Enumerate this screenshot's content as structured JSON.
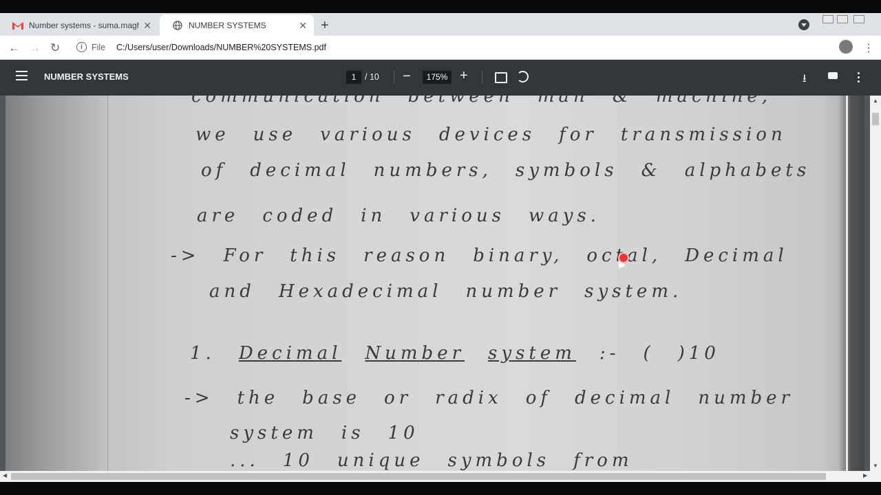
{
  "tabs": [
    {
      "title": "Number systems - suma.maghan",
      "favicon": "gmail-icon"
    },
    {
      "title": "NUMBER SYSTEMS",
      "favicon": "globe-icon"
    }
  ],
  "address": {
    "scheme_label": "File",
    "url": "C:/Users/user/Downloads/NUMBER%20SYSTEMS.pdf"
  },
  "pdf_viewer": {
    "title": "NUMBER SYSTEMS",
    "current_page": "1",
    "total_pages": "/ 10",
    "zoom": "175%"
  },
  "document_text": [
    [
      "communication",
      "between",
      "man",
      "&",
      "machine,"
    ],
    [
      "we",
      "use",
      "various",
      "devices",
      "for",
      "transmission"
    ],
    [
      "of",
      "decimal",
      "numbers,",
      "symbols",
      "&",
      "alphabets"
    ],
    [
      "are",
      "coded",
      "in",
      "various",
      "ways."
    ],
    [
      "->",
      "For",
      "this",
      "reason",
      "binary,",
      "octal,",
      "Decimal"
    ],
    [
      "and",
      "Hexadecimal",
      "number",
      "system."
    ],
    [
      "1.",
      "Decimal",
      "Number",
      "system",
      ":-",
      "(",
      ")10"
    ],
    [
      "->",
      "the",
      "base",
      "or",
      "radix",
      "of",
      "decimal",
      "number"
    ],
    [
      "system",
      "is",
      "10"
    ],
    [
      "...",
      "10",
      "unique",
      "symbols",
      "from"
    ]
  ]
}
